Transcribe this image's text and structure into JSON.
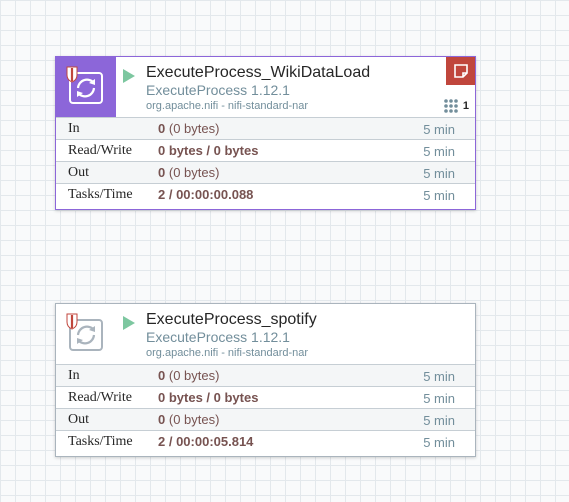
{
  "processors": [
    {
      "name": "ExecuteProcess_WikiDataLoad",
      "version": "ExecuteProcess 1.12.1",
      "bundle": "org.apache.nifi - nifi-standard-nar",
      "concurrent_tasks": "1",
      "accent_color": "#8c66d9",
      "icon": "processor-icon",
      "stats": {
        "in": {
          "label": "In",
          "value": "0",
          "size": "(0 bytes)",
          "time": "5 min"
        },
        "read_write": {
          "label": "Read/Write",
          "value": "0 bytes / 0 bytes",
          "time": "5 min"
        },
        "out": {
          "label": "Out",
          "value": "0",
          "size": "(0 bytes)",
          "time": "5 min"
        },
        "tasks_time": {
          "label": "Tasks/Time",
          "value": "2 / 00:00:00.088",
          "time": "5 min"
        }
      }
    },
    {
      "name": "ExecuteProcess_spotify",
      "version": "ExecuteProcess 1.12.1",
      "bundle": "org.apache.nifi - nifi-standard-nar",
      "icon": "processor-icon",
      "stats": {
        "in": {
          "label": "In",
          "value": "0",
          "size": "(0 bytes)",
          "time": "5 min"
        },
        "read_write": {
          "label": "Read/Write",
          "value": "0 bytes / 0 bytes",
          "time": "5 min"
        },
        "out": {
          "label": "Out",
          "value": "0",
          "size": "(0 bytes)",
          "time": "5 min"
        },
        "tasks_time": {
          "label": "Tasks/Time",
          "value": "2 / 00:00:05.814",
          "time": "5 min"
        }
      }
    }
  ],
  "colors": {
    "run_state": "#7dc7a0",
    "comments": "#c0463c",
    "stat_value": "#775351",
    "secondary_text": "#728e9b"
  }
}
